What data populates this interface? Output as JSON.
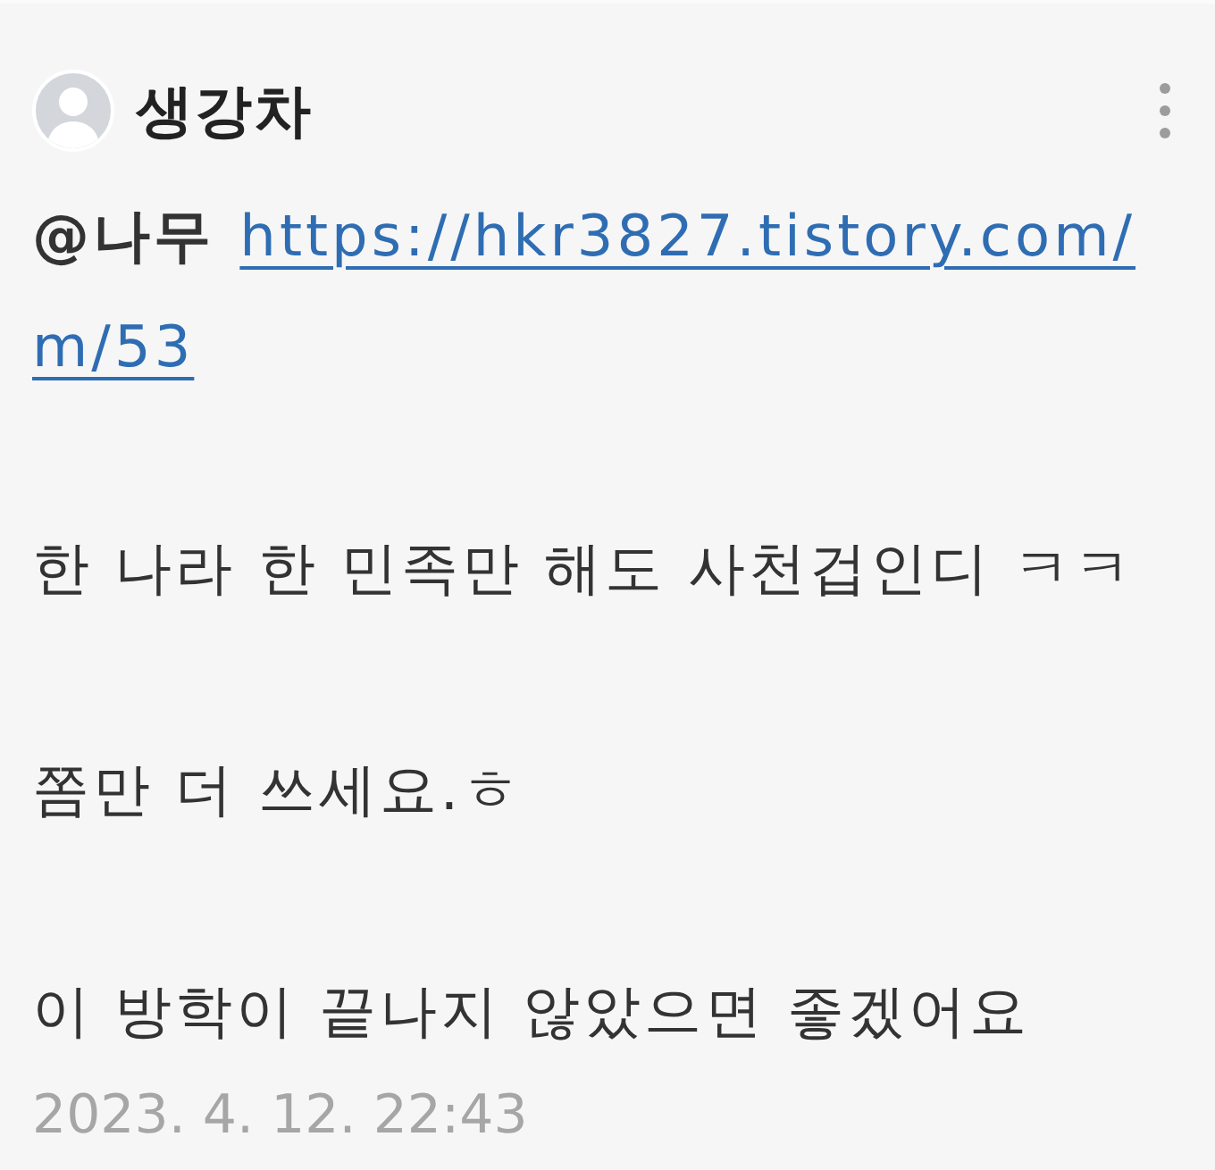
{
  "comment": {
    "author": "생강차",
    "mention": "@나무",
    "link": "https://hkr3827.tistory.com/m/53",
    "paragraphs": [
      "한 나라 한 민족만 해도 사천겁인디 ㅋㅋ",
      "쫌만 더 쓰세요.ㅎ",
      "이 방학이 끝나지 않았으면 좋겠어요"
    ],
    "timestamp": "2023. 4. 12. 22:43"
  }
}
